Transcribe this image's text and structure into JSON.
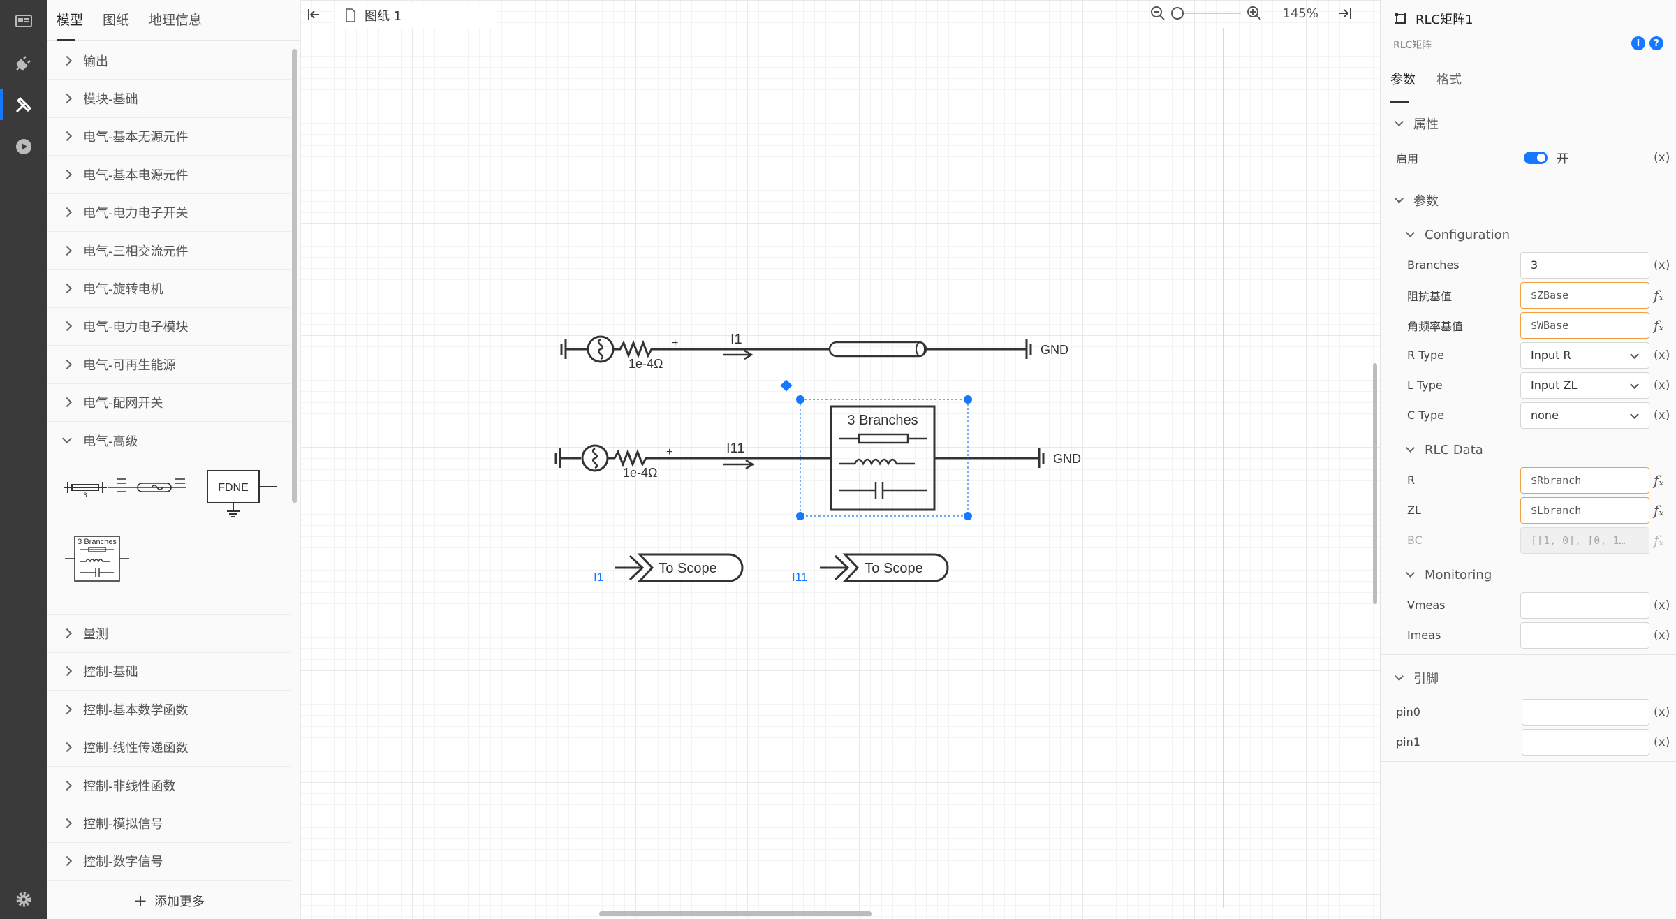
{
  "library": {
    "tabs": [
      "模型",
      "图纸",
      "地理信息"
    ],
    "items_top": [
      "输出",
      "模块-基础",
      "电气-基本无源元件",
      "电气-基本电源元件",
      "电气-电力电子开关",
      "电气-三相交流元件",
      "电气-旋转电机",
      "电气-电力电子模块",
      "电气-可再生能源",
      "电气-配网开关"
    ],
    "expanded_label": "电气-高级",
    "thumbs": {
      "fdne": "FDNE",
      "rlc": "3 Branches",
      "pi_count": "3"
    },
    "items_bottom": [
      "量测",
      "控制-基础",
      "控制-基本数学函数",
      "控制-线性传递函数",
      "控制-非线性函数",
      "控制-模拟信号",
      "控制-数字信号"
    ],
    "add_more": "添加更多"
  },
  "canvas": {
    "doc_tab": "图纸 1",
    "zoom": "145%",
    "row1": {
      "resistor": "1e-4Ω",
      "current": "I1",
      "ground": "GND",
      "plus": "+"
    },
    "row2": {
      "resistor": "1e-4Ω",
      "current": "I11",
      "ground": "GND",
      "plus": "+",
      "block": "3 Branches"
    },
    "scopes": [
      {
        "signal": "I1",
        "label": "To Scope"
      },
      {
        "signal": "I11",
        "label": "To Scope"
      }
    ]
  },
  "props": {
    "title": "RLC矩阵1",
    "subtitle": "RLC矩阵",
    "tabs": [
      "参数",
      "格式"
    ],
    "sec_attr": "属性",
    "enable_label": "启用",
    "enable_value": "开",
    "sec_params": "参数",
    "sub_config": "Configuration",
    "branches_label": "Branches",
    "branches_value": "3",
    "zbase_label": "阻抗基值",
    "zbase_value": "$ZBase",
    "wbase_label": "角频率基值",
    "wbase_value": "$WBase",
    "rtype_label": "R Type",
    "rtype_value": "Input R",
    "ltype_label": "L Type",
    "ltype_value": "Input ZL",
    "ctype_label": "C Type",
    "ctype_value": "none",
    "sub_rlc": "RLC Data",
    "r_label": "R",
    "r_value": "$Rbranch",
    "zl_label": "ZL",
    "zl_value": "$Lbranch",
    "bc_label": "BC",
    "bc_value": "[[1, 0], [0, 1…",
    "sub_mon": "Monitoring",
    "vmeas_label": "Vmeas",
    "imeas_label": "Imeas",
    "sec_pins": "引脚",
    "pin0_label": "pin0",
    "pin1_label": "pin1",
    "x_suffix": "(x)",
    "accent": "#1677ff"
  }
}
